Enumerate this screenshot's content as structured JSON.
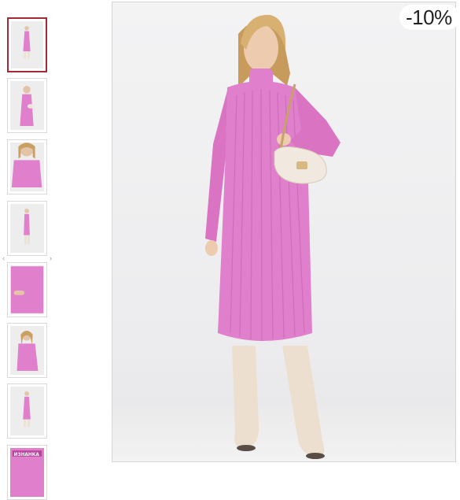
{
  "gallery": {
    "discount_badge": "-10%",
    "prev_arrow": "‹",
    "next_arrow": "›",
    "product_color": "#e07fcb",
    "active_border_color": "#a12a35",
    "thumbnails": [
      {
        "view": "full-front",
        "active": true
      },
      {
        "view": "full-front-bag"
      },
      {
        "view": "close-up-neck"
      },
      {
        "view": "full-side"
      },
      {
        "view": "detail-sleeve"
      },
      {
        "view": "three-quarter"
      },
      {
        "view": "full-front-2"
      },
      {
        "view": "inside-out",
        "label": "ИЗНАНКА"
      }
    ]
  }
}
